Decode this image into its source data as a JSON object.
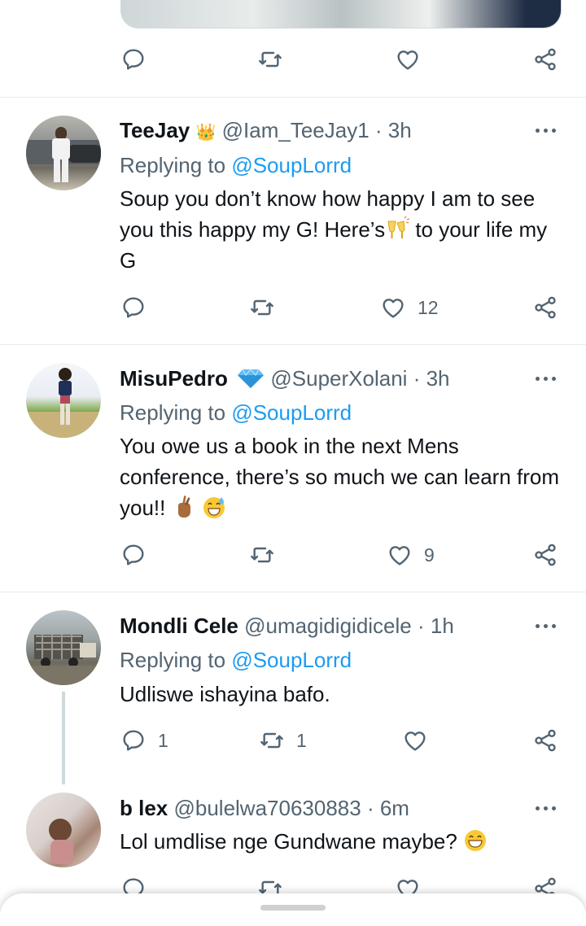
{
  "tweets": [
    {
      "name": "TeeJay",
      "badge": "👑",
      "handle": "@Iam_TeeJay1",
      "time": "· 3h",
      "reply_prefix": "Replying to",
      "reply_handle": "@SoupLorrd",
      "text_a": "Soup you don’t know how happy I am to see you this happy my G! Here’s",
      "text_b": " to your life my G",
      "emoji_1": "clinking-glasses",
      "likes": "12"
    },
    {
      "name": "MisuPedro",
      "badge": "gem-icon",
      "handle": "@SuperXolani",
      "time": "· 3h",
      "reply_prefix": "Replying to",
      "reply_handle": "@SoupLorrd",
      "text_a": "You owe us a book in the next Mens conference, there’s so much we can learn from you!!",
      "emoji_1": "crossed-fingers",
      "emoji_2": "grinning-sweat",
      "likes": "9"
    },
    {
      "name": "Mondli Cele",
      "handle": "@umagidigidicele",
      "time": "· 1h",
      "reply_prefix": "Replying to",
      "reply_handle": "@SoupLorrd",
      "text_a": "Udliswe ishayina bafo.",
      "replies": "1",
      "retweets": "1"
    },
    {
      "name": "b lex",
      "handle": "@bulelwa70630883",
      "time": "· 6m",
      "text_a": "Lol umdlise nge Gundwane maybe?",
      "emoji_1": "grinning-face"
    }
  ],
  "colors": {
    "accent": "#1d9bf0",
    "muted": "#536471",
    "text": "#0f1419",
    "divider": "#e6ecf0"
  }
}
